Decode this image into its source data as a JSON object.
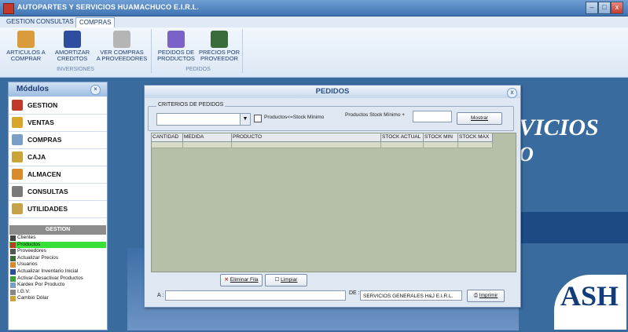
{
  "window": {
    "title": "AUTOPARTES Y SERVICIOS HUAMACHUCO E.I.R.L.",
    "controls": [
      "–",
      "□",
      "x"
    ]
  },
  "tabs": [
    {
      "label": "GESTION",
      "active": false
    },
    {
      "label": "CONSULTAS",
      "active": false
    },
    {
      "label": "COMPRAS",
      "active": true
    }
  ],
  "ribbon": {
    "groups": [
      {
        "label": "INVERSIONES",
        "buttons": [
          {
            "label": "ARTICULOS A\nCOMPRAR",
            "icon": "shopping-icon",
            "color": "#d99b3b"
          },
          {
            "label": "AMORTIZAR\nCREDITOS",
            "icon": "visa-card-icon",
            "color": "#2c4da0"
          },
          {
            "label": "VER COMPRAS\nA PROVEEDORES",
            "icon": "document-icon",
            "color": "#9b9b9b"
          }
        ]
      },
      {
        "label": "PEDIDOS",
        "buttons": [
          {
            "label": "PEDIDOS DE\nPRODUCTOS",
            "icon": "clipboard-icon",
            "color": "#7a62c9"
          },
          {
            "label": "PRECIOS POR\nPROVEEDOR",
            "icon": "people-icon",
            "color": "#3a6b3a"
          }
        ]
      }
    ]
  },
  "modules": {
    "title": "Módulos",
    "items": [
      {
        "label": "GESTION",
        "color": "#c0392b"
      },
      {
        "label": "VENTAS",
        "color": "#d9a52b"
      },
      {
        "label": "COMPRAS",
        "color": "#7b9ec8"
      },
      {
        "label": "CAJA",
        "color": "#caa43a"
      },
      {
        "label": "ALMACEN",
        "color": "#d98b2b"
      },
      {
        "label": "CONSULTAS",
        "color": "#7a7a7a"
      },
      {
        "label": "UTILIDADES",
        "color": "#c7a04a"
      }
    ],
    "gestion": {
      "title": "GESTION",
      "items": [
        {
          "label": "Clientes",
          "selected": false
        },
        {
          "label": "Productos",
          "selected": true
        },
        {
          "label": "Proveedores",
          "selected": false
        },
        {
          "label": "Actualizar Precios",
          "selected": false
        },
        {
          "label": "Usuarios",
          "selected": false
        },
        {
          "label": "Actualizar Inventario Inicial",
          "selected": false
        },
        {
          "label": "Activar-Desactivar Productos",
          "selected": false
        },
        {
          "label": "Kardex Por Producto",
          "selected": false
        },
        {
          "label": "I.G.V.",
          "selected": false
        },
        {
          "label": "Cambio Dólar",
          "selected": false
        }
      ]
    }
  },
  "background": {
    "brand_line1": "VICIOS",
    "brand_line2": "O",
    "logo": "ASH"
  },
  "dialog": {
    "title": "PEDIDOS",
    "close": "x",
    "criteria": {
      "legend": "CRITERIOS DE PEDIDOS",
      "select_value": "",
      "checkbox_label": "Productos<=Stock Mínimo",
      "stock_label": "Productos Stock Mínimo +",
      "stock_value": "",
      "show_button": "Mostrar"
    },
    "grid": {
      "columns": [
        "CANTIDAD",
        "MEDIDA",
        "PRODUCTO",
        "STOCK ACTUAL",
        "STOCK MIN",
        "STOCK MAX"
      ],
      "rows": [
        [
          "",
          "",
          "",
          "",
          "",
          ""
        ]
      ]
    },
    "delete_button": "Eliminar Fila",
    "clear_button": "Limpiar",
    "to_label": "A :",
    "to_value": "",
    "from_label": "DE :",
    "from_value": "SERVICIOS GENERALES H&J E.I.R.L.",
    "print_button": "Imprimir"
  }
}
